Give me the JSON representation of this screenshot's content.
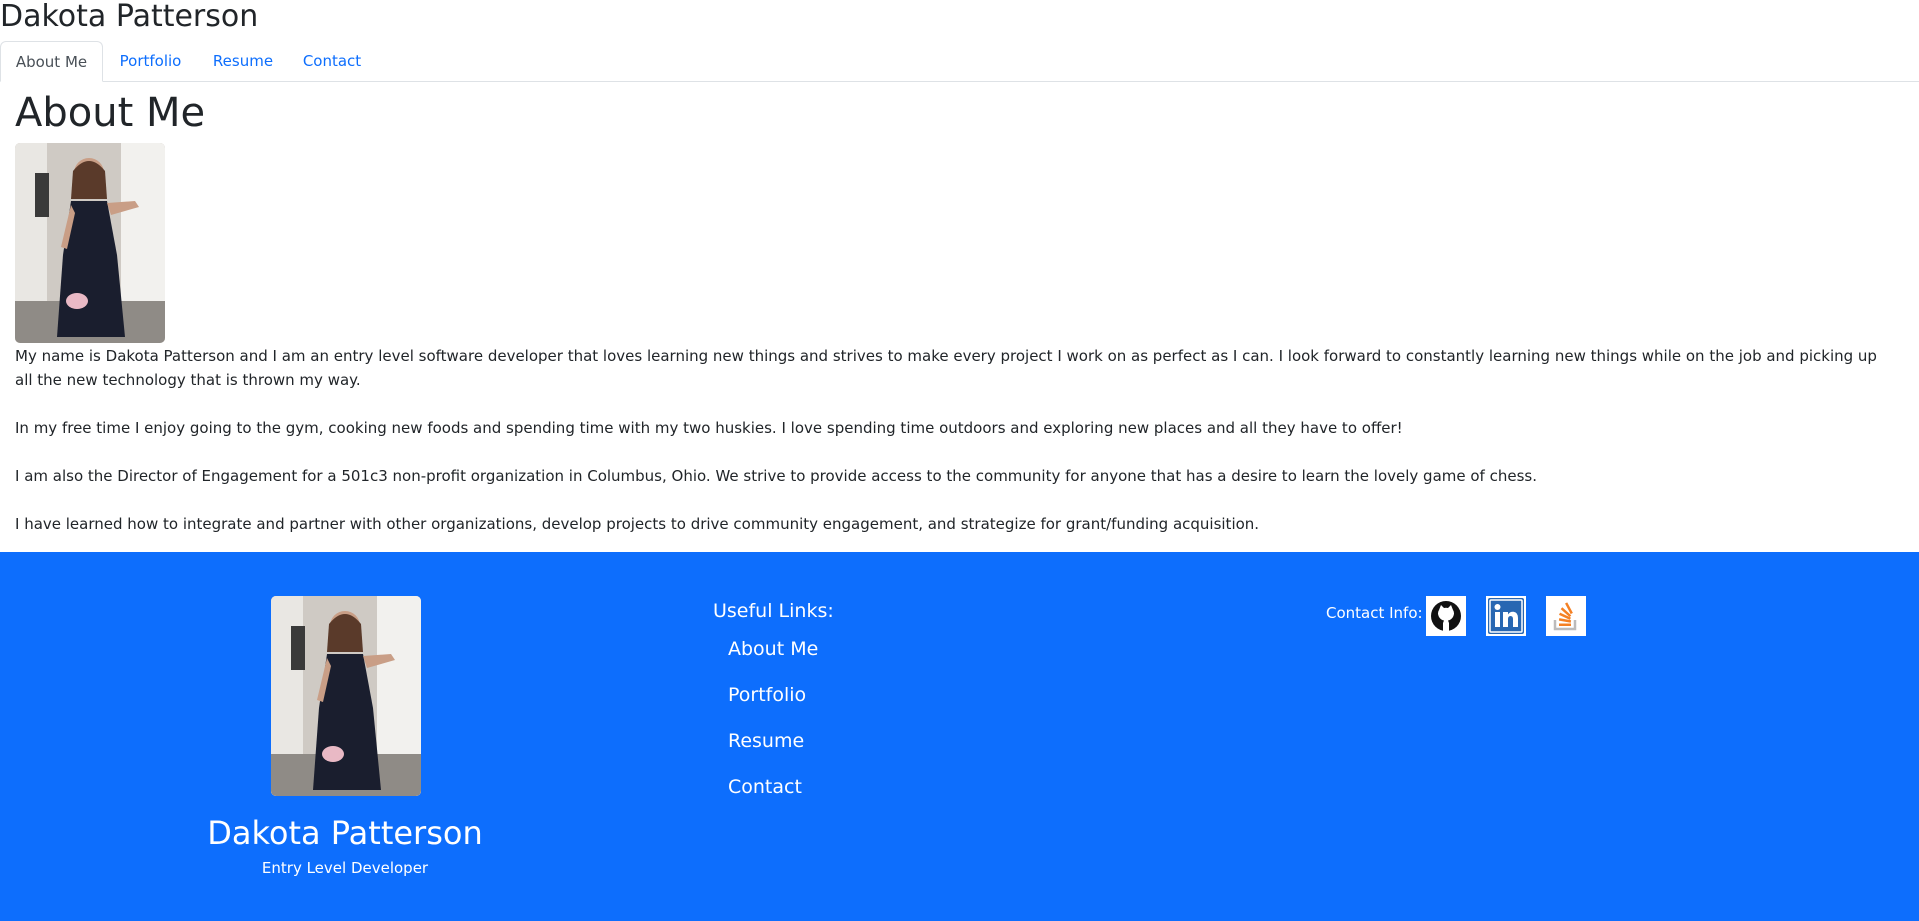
{
  "site": {
    "title": "Dakota Patterson"
  },
  "nav": {
    "tabs": [
      {
        "label": "About Me",
        "active": true
      },
      {
        "label": "Portfolio",
        "active": false
      },
      {
        "label": "Resume",
        "active": false
      },
      {
        "label": "Contact",
        "active": false
      }
    ]
  },
  "about": {
    "heading": "About Me",
    "paragraphs": [
      "My name is Dakota Patterson and I am an entry level software developer that loves learning new things and strives to make every project I work on as perfect as I can. I look forward to constantly learning new things while on the job and picking up all the new technology that is thrown my way.",
      "In my free time I enjoy going to the gym, cooking new foods and spending time with my two huskies. I love spending time outdoors and exploring new places and all they have to offer!",
      "I am also the Director of Engagement for a 501c3 non-profit organization in Columbus, Ohio. We strive to provide access to the community for anyone that has a desire to learn the lovely game of chess.",
      "I have learned how to integrate and partner with other organizations, develop projects to drive community engagement, and strategize for grant/funding acquisition."
    ]
  },
  "footer": {
    "name": "Dakota Patterson",
    "role": "Entry Level Developer",
    "links_heading": "Useful Links:",
    "links": [
      "About Me",
      "Portfolio",
      "Resume",
      "Contact"
    ],
    "contact_label": "Contact Info:",
    "social_icons": [
      "github-icon",
      "linkedin-icon",
      "stackoverflow-icon"
    ]
  },
  "colors": {
    "accent": "#0d6efd",
    "text": "#212529",
    "linkedin": "#2867b2",
    "stackoverflow": "#f48024"
  }
}
